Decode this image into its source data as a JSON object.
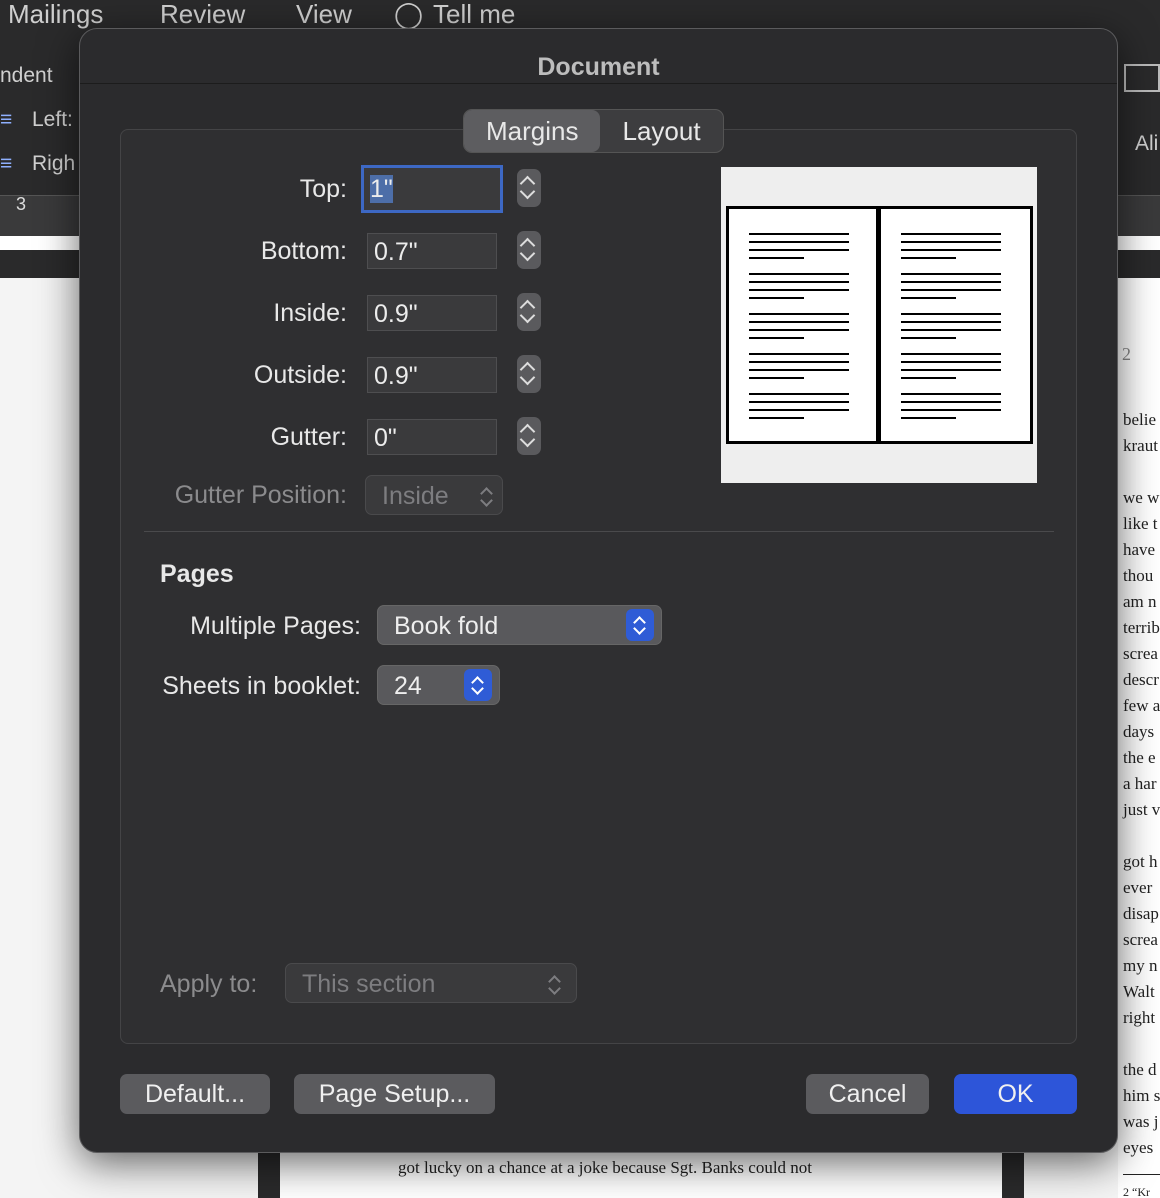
{
  "app": {
    "menu": [
      "Mailings",
      "Review",
      "View",
      "Tell me"
    ],
    "ribbon": {
      "indent_label": "ndent",
      "left_label": "Left:",
      "right_label": "Righ",
      "align_label": "Ali",
      "ruler_number": "3"
    },
    "document_text": {
      "bottom_line": "got lucky on a chance at a joke because Sgt. Banks could not",
      "page_number": "2",
      "right_words": [
        "belie",
        "kraut",
        "",
        "we w",
        "like t",
        "have",
        "thou",
        "am n",
        "terrib",
        "screa",
        "descr",
        "few a",
        "days",
        "the e",
        "a har",
        "just v",
        "",
        "got h",
        "ever",
        "disap",
        "screa",
        "my n",
        "Walt",
        "right",
        "",
        "the d",
        "him s",
        "was j",
        "eyes"
      ],
      "footnote": "2 “Kr"
    }
  },
  "dialog": {
    "title": "Document",
    "tabs": [
      {
        "label": "Margins",
        "active": true
      },
      {
        "label": "Layout",
        "active": false
      }
    ],
    "margins": {
      "top": {
        "label": "Top:",
        "value": "1\""
      },
      "bottom": {
        "label": "Bottom:",
        "value": "0.7\""
      },
      "inside": {
        "label": "Inside:",
        "value": "0.9\""
      },
      "outside": {
        "label": "Outside:",
        "value": "0.9\""
      },
      "gutter": {
        "label": "Gutter:",
        "value": "0\""
      },
      "gutter_position": {
        "label": "Gutter Position:",
        "value": "Inside",
        "enabled": false
      }
    },
    "pages": {
      "heading": "Pages",
      "multiple_pages": {
        "label": "Multiple Pages:",
        "value": "Book fold"
      },
      "sheets": {
        "label": "Sheets in booklet:",
        "value": "24"
      }
    },
    "apply_to": {
      "label": "Apply to:",
      "value": "This section",
      "enabled": false
    },
    "buttons": {
      "default": "Default...",
      "page_setup": "Page Setup...",
      "cancel": "Cancel",
      "ok": "OK"
    }
  },
  "colors": {
    "dialog_bg": "#2b2b2d",
    "accent": "#2d55d9",
    "focus": "#3d68c4"
  }
}
